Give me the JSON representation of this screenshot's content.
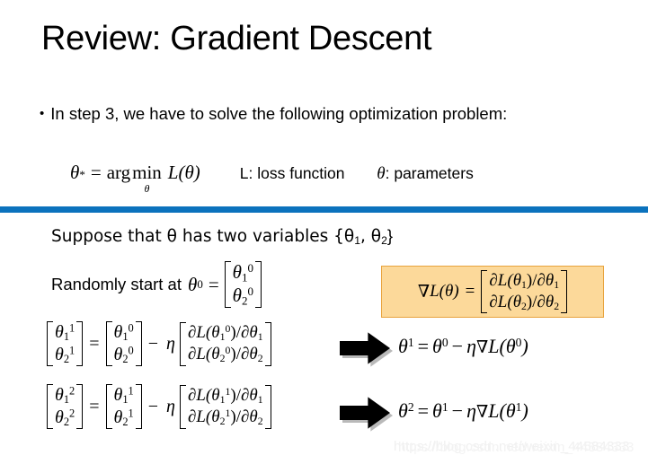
{
  "slide": {
    "title": "Review: Gradient Descent",
    "bullet": {
      "marker": "•",
      "text": "In step 3, we have to solve the following optimization problem:"
    },
    "argmin_equation": {
      "theta_star": "θ",
      "star": "*",
      "equals": "=",
      "arg": "arg",
      "min": "min",
      "under_variable": "θ",
      "loss": "L(θ)"
    },
    "legend": {
      "loss_function": "L: loss function",
      "parameters_symbol": "θ",
      "parameters_text": ": parameters"
    },
    "divider_color": "#0b72bd",
    "lower": {
      "suppose_prefix": "Suppose that θ has two variables {θ",
      "suppose_sub1": "1",
      "suppose_mid": ", θ",
      "suppose_sub2": "2",
      "suppose_suffix": "}",
      "randomly_text": "Randomly start at",
      "randomly_theta": "θ",
      "randomly_sup": "0",
      "randomly_equals": "=",
      "start_vector": {
        "row1_base": "θ",
        "row1_sub": "1",
        "row1_sup": "0",
        "row2_base": "θ",
        "row2_sub": "2",
        "row2_sup": "0"
      }
    },
    "gradient_box": {
      "nabla": "∇",
      "lhs": "L(θ)",
      "equals": "=",
      "row1": "∂L(θ1)/∂θ1",
      "row2": "∂L(θ2)/∂θ2",
      "row1_parts": {
        "d": "∂",
        "L": "L(",
        "base": "θ",
        "sub": "1",
        "close": ")/",
        "d2": "∂",
        "base2": "θ",
        "sub2": "1"
      },
      "row2_parts": {
        "d": "∂",
        "L": "L(",
        "base": "θ",
        "sub": "2",
        "close": ")/",
        "d2": "∂",
        "base2": "θ",
        "sub2": "2"
      },
      "fill_color": "#fcd99a",
      "border_color": "#e8a33d"
    },
    "update_rows": [
      {
        "lhs": {
          "row1": {
            "base": "θ",
            "sub": "1",
            "sup": "1"
          },
          "row2": {
            "base": "θ",
            "sub": "2",
            "sup": "1"
          }
        },
        "equals": "=",
        "rhs_vec": {
          "row1": {
            "base": "θ",
            "sub": "1",
            "sup": "0"
          },
          "row2": {
            "base": "θ",
            "sub": "2",
            "sup": "0"
          }
        },
        "minus": "−",
        "eta": "η",
        "grad_vec": {
          "row1": {
            "d": "∂",
            "L": "L(",
            "base": "θ",
            "sub": "1",
            "sup": "0",
            "close": ")/",
            "d2": "∂",
            "base2": "θ",
            "sub2": "1"
          },
          "row2": {
            "d": "∂",
            "L": "L(",
            "base": "θ",
            "sub": "2",
            "sup": "0",
            "close": ")/",
            "d2": "∂",
            "base2": "θ",
            "sub2": "2"
          }
        },
        "result": {
          "lhs_base": "θ",
          "lhs_sup": "1",
          "equals": "=",
          "rhs_base": "θ",
          "rhs_sup": "0",
          "minus": "−",
          "eta": "η",
          "nabla": "∇",
          "L": "L(",
          "arg_base": "θ",
          "arg_sup": "0",
          "close": ")"
        }
      },
      {
        "lhs": {
          "row1": {
            "base": "θ",
            "sub": "1",
            "sup": "2"
          },
          "row2": {
            "base": "θ",
            "sub": "2",
            "sup": "2"
          }
        },
        "equals": "=",
        "rhs_vec": {
          "row1": {
            "base": "θ",
            "sub": "1",
            "sup": "1"
          },
          "row2": {
            "base": "θ",
            "sub": "2",
            "sup": "1"
          }
        },
        "minus": "−",
        "eta": "η",
        "grad_vec": {
          "row1": {
            "d": "∂",
            "L": "L(",
            "base": "θ",
            "sub": "1",
            "sup": "1",
            "close": ")/",
            "d2": "∂",
            "base2": "θ",
            "sub2": "1"
          },
          "row2": {
            "d": "∂",
            "L": "L(",
            "base": "θ",
            "sub": "2",
            "sup": "1",
            "close": ")/",
            "d2": "∂",
            "base2": "θ",
            "sub2": "2"
          }
        },
        "result": {
          "lhs_base": "θ",
          "lhs_sup": "2",
          "equals": "=",
          "rhs_base": "θ",
          "rhs_sup": "1",
          "minus": "−",
          "eta": "η",
          "nabla": "∇",
          "L": "L(",
          "arg_base": "θ",
          "arg_sup": "1",
          "close": ")"
        }
      }
    ],
    "watermark": "https://blog.csdn.net/weixin_44584333"
  }
}
